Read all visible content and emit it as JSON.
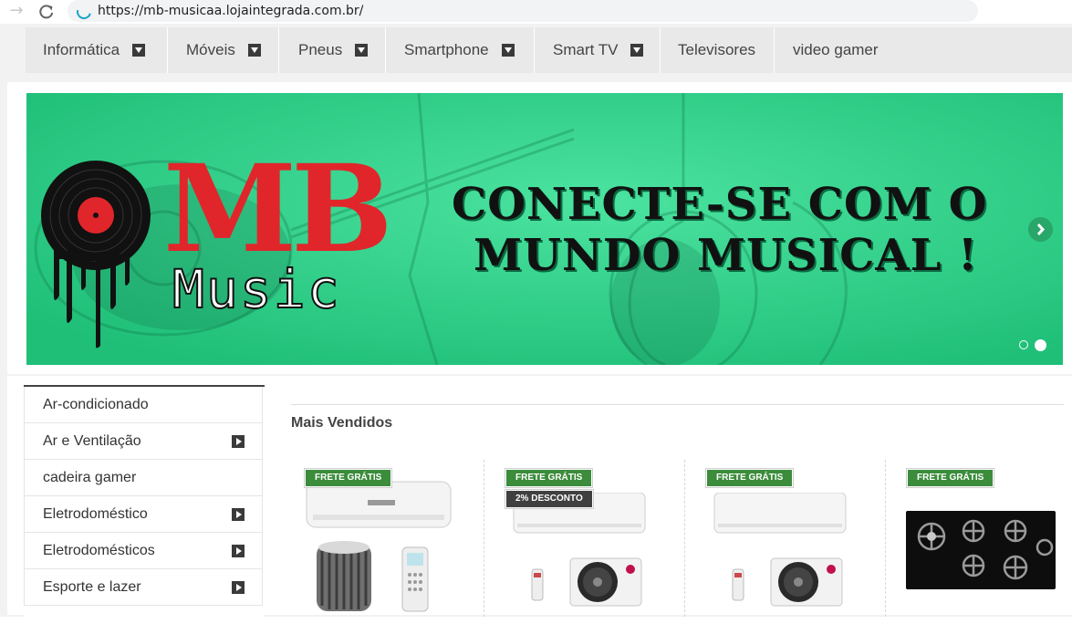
{
  "browser": {
    "url": "https://mb-musicaa.lojaintegrada.com.br/"
  },
  "menu": {
    "items": [
      {
        "label": "Informática",
        "has_dropdown": true
      },
      {
        "label": "Móveis",
        "has_dropdown": true
      },
      {
        "label": "Pneus",
        "has_dropdown": true
      },
      {
        "label": "Smartphone",
        "has_dropdown": true
      },
      {
        "label": "Smart TV",
        "has_dropdown": true
      },
      {
        "label": "Televisores",
        "has_dropdown": false
      },
      {
        "label": "video gamer",
        "has_dropdown": false
      }
    ]
  },
  "banner": {
    "logo_text": "MB",
    "logo_subtext": "Music",
    "headline_line1": "CONECTE-SE COM O",
    "headline_line2": "MUNDO MUSICAL !",
    "slides_total": 2,
    "slide_active": 2,
    "colors": {
      "background": "#2fdc8c",
      "logo_red": "#e0262b",
      "headline": "#111111"
    }
  },
  "sidebar": {
    "categories": [
      {
        "label": "Ar-condicionado",
        "has_submenu": false
      },
      {
        "label": "Ar e Ventilação",
        "has_submenu": true
      },
      {
        "label": "cadeira gamer",
        "has_submenu": false
      },
      {
        "label": "Eletrodoméstico",
        "has_submenu": true
      },
      {
        "label": "Eletrodomésticos",
        "has_submenu": true
      },
      {
        "label": "Esporte e lazer",
        "has_submenu": true
      }
    ]
  },
  "products": {
    "section_title": "Mais Vendidos",
    "items": [
      {
        "badges": [
          "FRETE GRÁTIS"
        ],
        "image": "air-conditioner-split-white-with-outdoor-unit-and-remote"
      },
      {
        "badges": [
          "FRETE GRÁTIS",
          "2% DESCONTO"
        ],
        "image": "lg-air-conditioner-split"
      },
      {
        "badges": [
          "FRETE GRÁTIS"
        ],
        "image": "lg-air-conditioner-split"
      },
      {
        "badges": [
          "FRETE GRÁTIS"
        ],
        "image": "gas-cooktop-black-5-burners"
      }
    ]
  }
}
